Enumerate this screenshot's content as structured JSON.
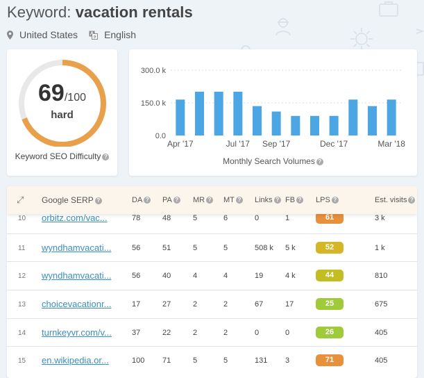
{
  "header": {
    "title_prefix": "Keyword: ",
    "keyword": "vacation rentals",
    "location": "United States",
    "language": "English"
  },
  "difficulty": {
    "score": "69",
    "out_of": "/100",
    "label": "hard",
    "caption": "Keyword SEO Difficulty",
    "value": 69,
    "max": 100,
    "color": "#e9a04a",
    "track_color": "#e8e8e8"
  },
  "chart_data": {
    "type": "bar",
    "title": "",
    "xlabel": "Monthly Search Volumes",
    "ylabel": "",
    "categories": [
      "Apr '17",
      "May '17",
      "Jun '17",
      "Jul '17",
      "Aug '17",
      "Sep '17",
      "Oct '17",
      "Nov '17",
      "Dec '17",
      "Jan '18",
      "Feb '18",
      "Mar '18"
    ],
    "tick_labels_x": [
      "Apr '17",
      "Jul '17",
      "Sep '17",
      "Dec '17",
      "Mar '18"
    ],
    "tick_labels_x_index": [
      0,
      3,
      5,
      8,
      11
    ],
    "y_ticks": [
      0,
      150000,
      300000
    ],
    "y_tick_labels": [
      "0.0",
      "150.0 k",
      "300.0 k"
    ],
    "ylim": [
      0,
      300000
    ],
    "grid": true,
    "values": [
      165000,
      201000,
      201000,
      201000,
      135000,
      110000,
      90000,
      90000,
      90000,
      165000,
      135000,
      165000
    ],
    "color": "#4ba6e3"
  },
  "table": {
    "headers": {
      "expand": "⤢",
      "serp": "Google SERP",
      "da": "DA",
      "pa": "PA",
      "mr": "MR",
      "mt": "MT",
      "links": "Links",
      "fb": "FB",
      "lps": "LPS",
      "visits": "Est. visits"
    },
    "rows": [
      {
        "num": "10",
        "url": "orbitz.com/vac...",
        "da": "78",
        "pa": "48",
        "mr": "5",
        "mt": "6",
        "links": "0",
        "fb": "1",
        "lps": "61",
        "lps_color": "#e8913c",
        "visits": "3 k"
      },
      {
        "num": "11",
        "url": "wyndhamvacati...",
        "da": "56",
        "pa": "51",
        "mr": "5",
        "mt": "5",
        "links": "508 k",
        "fb": "5 k",
        "lps": "52",
        "lps_color": "#d4b626",
        "visits": "1 k"
      },
      {
        "num": "12",
        "url": "wyndhamvacati...",
        "da": "56",
        "pa": "40",
        "mr": "4",
        "mt": "4",
        "links": "19",
        "fb": "4 k",
        "lps": "44",
        "lps_color": "#c3bd24",
        "visits": "810"
      },
      {
        "num": "13",
        "url": "choicevacationr...",
        "da": "17",
        "pa": "27",
        "mr": "2",
        "mt": "2",
        "links": "67",
        "fb": "17",
        "lps": "25",
        "lps_color": "#9fcb3a",
        "visits": "675"
      },
      {
        "num": "14",
        "url": "turnkeyvr.com/v...",
        "da": "37",
        "pa": "22",
        "mr": "2",
        "mt": "2",
        "links": "0",
        "fb": "0",
        "lps": "26",
        "lps_color": "#9fcb3a",
        "visits": "405"
      },
      {
        "num": "15",
        "url": "en.wikipedia.or...",
        "da": "100",
        "pa": "71",
        "mr": "5",
        "mt": "5",
        "links": "131",
        "fb": "3",
        "lps": "71",
        "lps_color": "#e8913c",
        "visits": "405"
      }
    ]
  }
}
